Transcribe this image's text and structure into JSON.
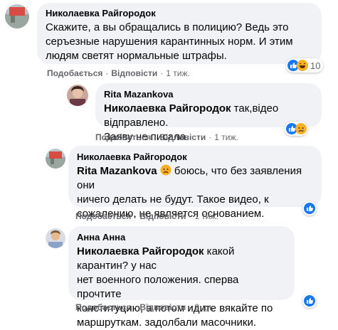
{
  "comments": [
    {
      "author": "Николаевка Райгородок",
      "lines": [
        "Скажите, а вы обращались в полицию? Ведь это",
        "серъезные нарушения карантинных норм. И этим",
        "людям светят нормальные штрафы."
      ],
      "like_label": "Подобається",
      "reply_label": "Відповісти",
      "time": "1 тиж.",
      "reaction_count": "10",
      "reactions": [
        "like-icon",
        "haha-icon"
      ]
    },
    {
      "author": "Rita Mazankova",
      "mention": "Николаевка Райгородок",
      "text_after_mention": " так,відео відправлено.",
      "line2": "Заяву не писала.",
      "like_label": "Подобається",
      "reply_label": "Відповісти",
      "time": "1 тиж.",
      "reactions": [
        "like-icon",
        "sad-icon"
      ]
    },
    {
      "author": "Николаевка Райгородок",
      "mention": "Rita Mazankova",
      "text_after_mention": " боюсь, что без заявления они",
      "line2": "ничего делать не будут. Такое видео, к",
      "line3": "сожалению, не является основанием.",
      "like_label": "Подобається",
      "reply_label": "Відповісти",
      "time": "1 тиж.",
      "reactions": [
        "like-icon"
      ]
    },
    {
      "author": "Анна Анна",
      "mention": "Николаевка Райгородок",
      "text_after_mention": " какой карантин? у нас",
      "line2": "нет военного положения. сперва прочтите",
      "line3": "конституцию, а потом идите вякайте по",
      "line4": "маршруткам. задолбали масочники.",
      "like_label": "Подобається",
      "reply_label": "Відповісти",
      "time": "2 дн.",
      "reactions": [
        "like-icon"
      ]
    }
  ],
  "colors": {
    "bubble": "#f0f2f5",
    "meta": "#65676b",
    "like_blue": "#1877f2",
    "haha_yellow": "#f7b125"
  }
}
